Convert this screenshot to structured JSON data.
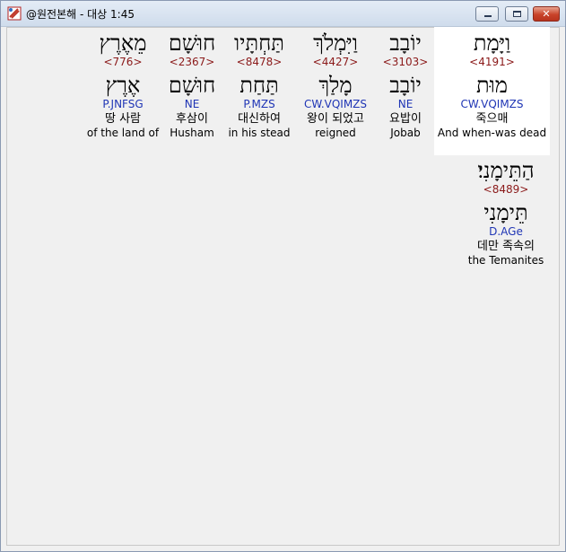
{
  "window": {
    "title": "@원전본해 - 대상 1:45"
  },
  "words": [
    {
      "id": "w1",
      "surface": "וַיָּמָת",
      "strong": "<4191>",
      "lemma": "מוּת",
      "parse": "CW.VQIMZS",
      "korean": "죽으매",
      "english": "And when-was dead",
      "selected": true
    },
    {
      "id": "w2",
      "surface": "יוֹבָב",
      "strong": "<3103>",
      "lemma": "יוֹבָב",
      "parse": "NE",
      "korean": "요밥이",
      "english": "Jobab",
      "selected": false
    },
    {
      "id": "w3",
      "surface": "וַיִּמְלֹךְ",
      "strong": "<4427>",
      "lemma": "מָלַךְ",
      "parse": "CW.VQIMZS",
      "korean": "왕이 되었고",
      "english": "reigned",
      "selected": false
    },
    {
      "id": "w4",
      "surface": "תַּחְתָּיו",
      "strong": "<8478>",
      "lemma": "תַּחַת",
      "parse": "P.MZS",
      "korean": "대신하여",
      "english": "in his stead",
      "selected": false
    },
    {
      "id": "w5",
      "surface": "חוּשָׁם",
      "strong": "<2367>",
      "lemma": "חוּשָׁם",
      "parse": "NE",
      "korean": "후삼이",
      "english": "Husham",
      "selected": false
    },
    {
      "id": "w6",
      "surface": "מֵאֶרֶץ",
      "strong": "<776>",
      "lemma": "אֶרֶץ",
      "parse": "P.JNFSG",
      "korean": "땅 사람",
      "english": "of the land of",
      "selected": false
    },
    {
      "id": "w7",
      "surface": "הַתֵּימָנִי׃",
      "strong": "<8489>",
      "lemma": "תֵּימָנִי",
      "parse": "D.AGe",
      "korean": "데만 족속의",
      "english": "the Temanites",
      "selected": false
    }
  ],
  "colors": {
    "strong": "#8b1a1a",
    "parse": "#1f35b5",
    "selected_bg": "#ffffff",
    "background": "#f0f0f0"
  },
  "icons": {
    "app": "book-app-icon",
    "minimize": "minimize-icon",
    "maximize": "maximize-icon",
    "close": "close-icon"
  }
}
